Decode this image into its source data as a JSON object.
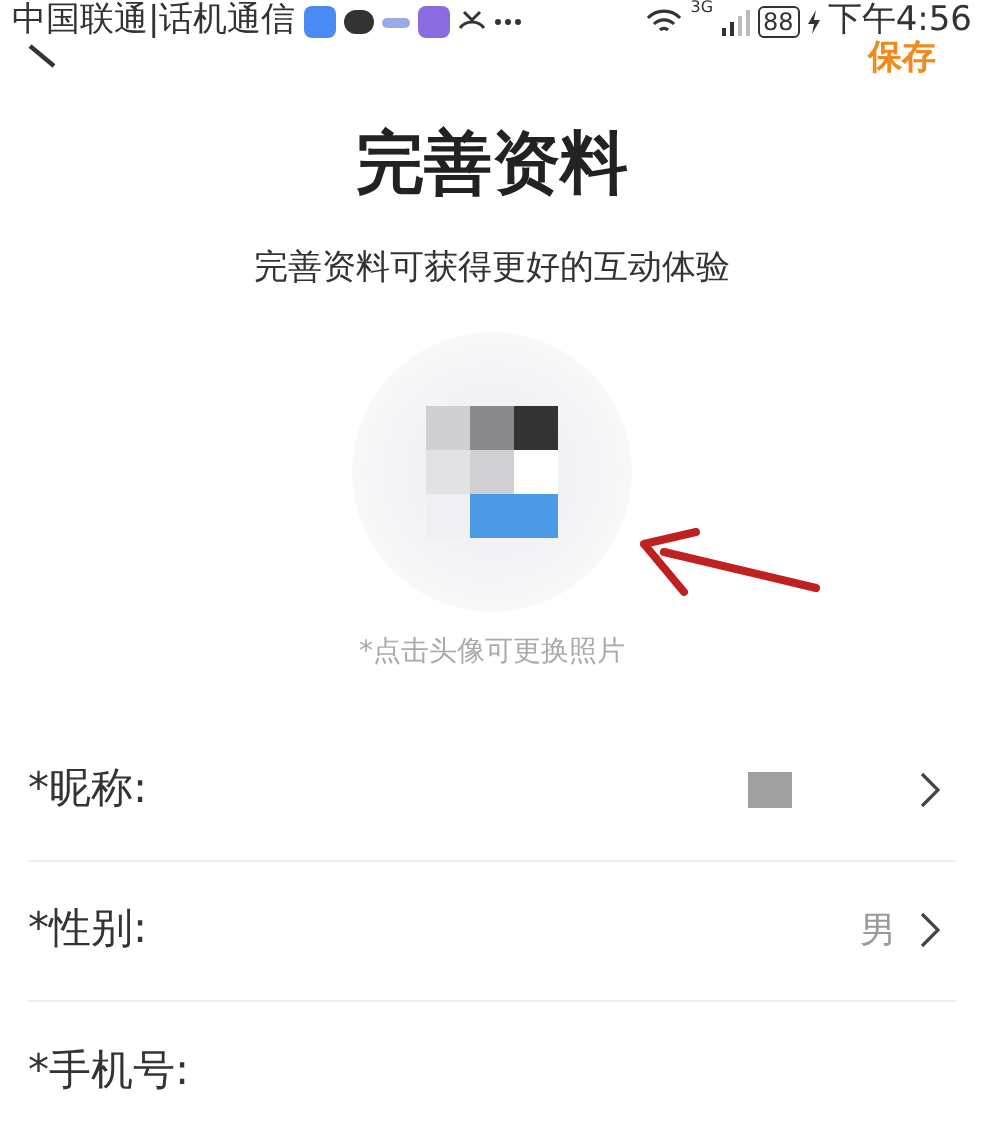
{
  "status_bar": {
    "carrier": "中国联通|话机通信",
    "network": "3G",
    "battery": "88",
    "time": "下午4:56"
  },
  "header": {
    "save": "保存"
  },
  "title": "完善资料",
  "subtitle": "完善资料可获得更好的互动体验",
  "avatar_hint": "*点击头像可更换照片",
  "fields": [
    {
      "label": "*昵称:",
      "kind": "hidden"
    },
    {
      "label": "*性别:",
      "kind": "text",
      "value": "男"
    },
    {
      "label": "*手机号:",
      "kind": "none"
    }
  ]
}
